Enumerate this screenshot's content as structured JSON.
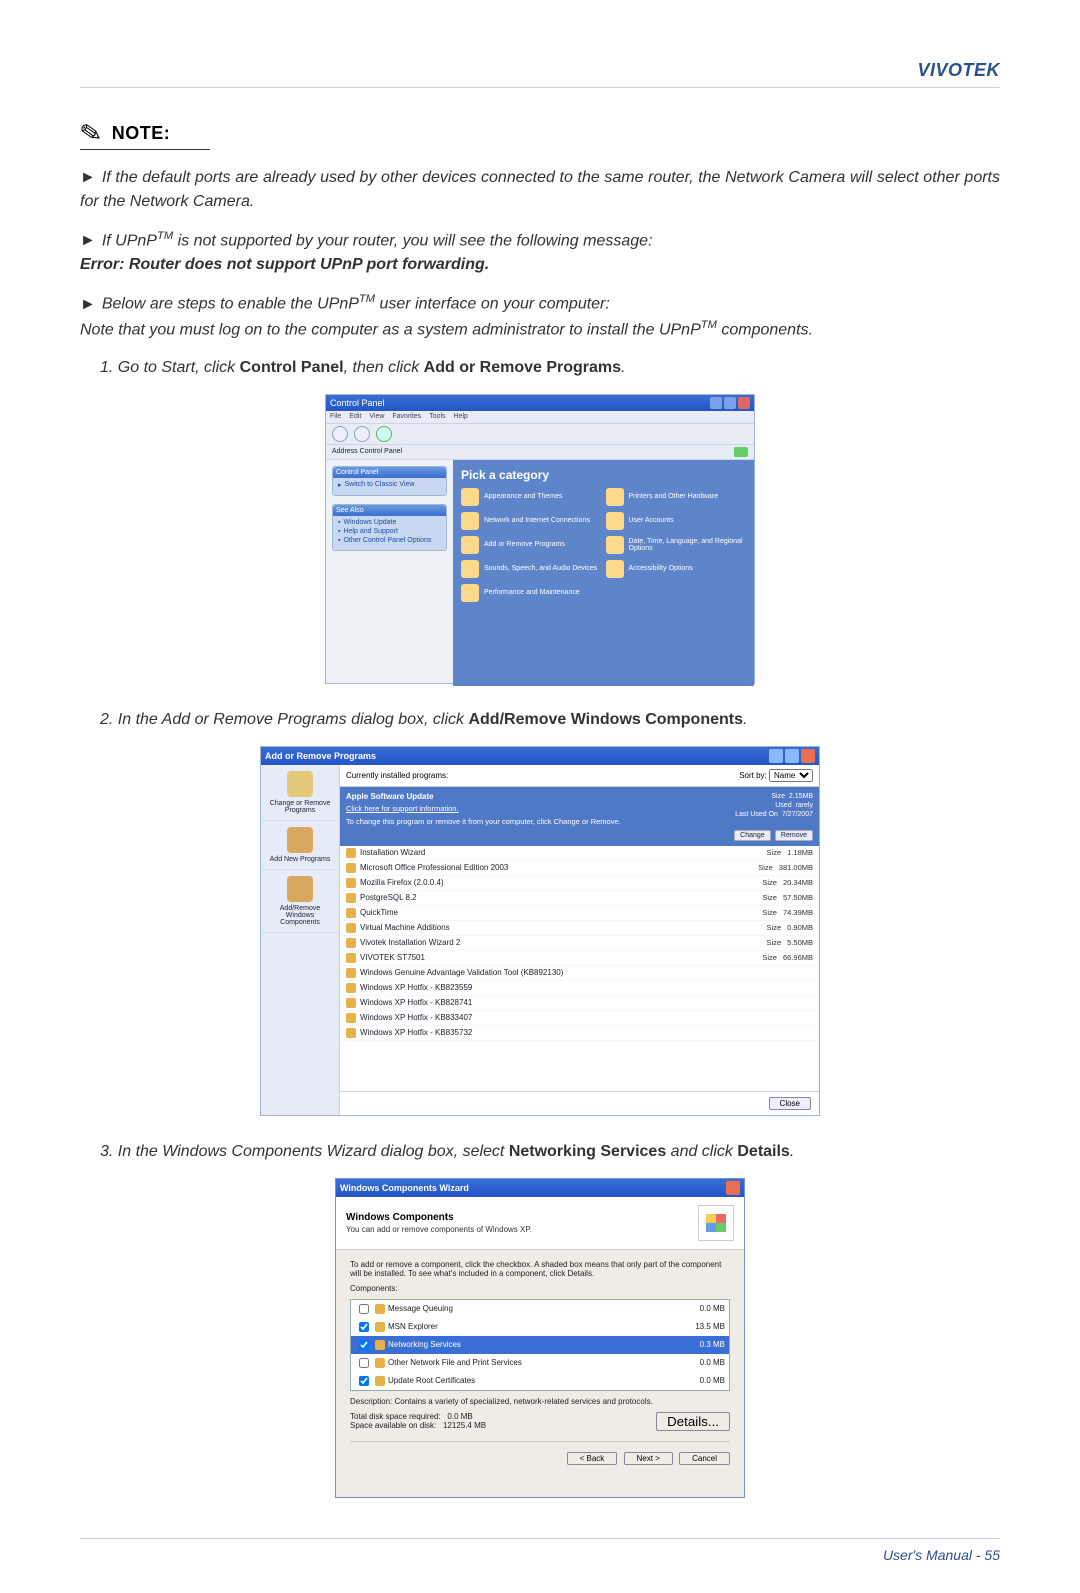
{
  "brand": "VIVOTEK",
  "note_label": "NOTE:",
  "bullets": {
    "b1": "If the default ports are already used by other devices connected to the same router, the Network Camera will select other ports for the Network Camera.",
    "b2_pre": "If UPnP",
    "b2_tm": "TM",
    "b2_post": " is not supported by your router, you will see the following message:",
    "b2_error": "Error: Router does not support UPnP port forwarding.",
    "b3_pre": "Below are steps to enable the UPnP",
    "b3_tm": "TM",
    "b3_post": " user interface on your computer:",
    "b3_note_pre": "Note that you must log on to the computer as a system administrator to install the UPnP",
    "b3_note_tm": "TM",
    "b3_note_post": " components."
  },
  "steps": {
    "s1_pre": "1. Go to Start, click ",
    "s1_bold1": "Control Panel",
    "s1_mid": ", then click ",
    "s1_bold2": "Add or Remove Programs",
    "s1_end": ".",
    "s2_pre": "2. In the Add or Remove Programs dialog box, click ",
    "s2_bold": "Add/Remove Windows Components",
    "s2_end": ".",
    "s3_pre": "3. In the Windows Components Wizard dialog box, select ",
    "s3_bold1": "Networking Services",
    "s3_mid": " and click ",
    "s3_bold2": "Details",
    "s3_end": "."
  },
  "cp": {
    "title": "Control Panel",
    "menu": [
      "File",
      "Edit",
      "View",
      "Favorites",
      "Tools",
      "Help"
    ],
    "address_label": "Address",
    "address_value": "Control Panel",
    "side_panel1_title": "Control Panel",
    "side_panel1_link": "Switch to Classic View",
    "side_panel2_title": "See Also",
    "side_panel2_links": [
      "Windows Update",
      "Help and Support",
      "Other Control Panel Options"
    ],
    "main_heading": "Pick a category",
    "categories": [
      "Appearance and Themes",
      "Printers and Other Hardware",
      "Network and Internet Connections",
      "User Accounts",
      "Add or Remove Programs",
      "Date, Time, Language, and Regional Options",
      "Sounds, Speech, and Audio Devices",
      "Accessibility Options",
      "Performance and Maintenance"
    ]
  },
  "arp": {
    "title": "Add or Remove Programs",
    "side": [
      {
        "label": "Change or Remove Programs"
      },
      {
        "label": "Add New Programs"
      },
      {
        "label": "Add/Remove Windows Components"
      }
    ],
    "top_label": "Currently installed programs:",
    "sort_label": "Sort by:",
    "sort_value": "Name",
    "selected": {
      "name": "Apple Software Update",
      "support": "Click here for support information.",
      "sizelabel": "Size",
      "size": "2.15MB",
      "usedlabel": "Used",
      "used": "rarely",
      "lastlabel": "Last Used On",
      "last": "7/27/2007",
      "msg": "To change this program or remove it from your computer, click Change or Remove.",
      "btn_change": "Change",
      "btn_remove": "Remove"
    },
    "rows": [
      {
        "name": "Installation Wizard",
        "size": "1.18MB"
      },
      {
        "name": "Microsoft Office Professional Edition 2003",
        "size": "381.00MB"
      },
      {
        "name": "Mozilla Firefox (2.0.0.4)",
        "size": "20.34MB"
      },
      {
        "name": "PostgreSQL 8.2",
        "size": "57.50MB"
      },
      {
        "name": "QuickTime",
        "size": "74.39MB"
      },
      {
        "name": "Virtual Machine Additions",
        "size": "0.90MB"
      },
      {
        "name": "Vivotek Installation Wizard 2",
        "size": "5.50MB"
      },
      {
        "name": "VIVOTEK ST7501",
        "size": "66.96MB"
      },
      {
        "name": "Windows Genuine Advantage Validation Tool (KB892130)",
        "size": ""
      },
      {
        "name": "Windows XP Hotfix - KB823559",
        "size": ""
      },
      {
        "name": "Windows XP Hotfix - KB828741",
        "size": ""
      },
      {
        "name": "Windows XP Hotfix - KB833407",
        "size": ""
      },
      {
        "name": "Windows XP Hotfix - KB835732",
        "size": ""
      }
    ],
    "size_col": "Size",
    "close": "Close"
  },
  "wcw": {
    "title": "Windows Components Wizard",
    "head_title": "Windows Components",
    "head_sub": "You can add or remove components of Windows XP.",
    "instr": "To add or remove a component, click the checkbox. A shaded box means that only part of the component will be installed. To see what's included in a component, click Details.",
    "components_label": "Components:",
    "items": [
      {
        "name": "Message Queuing",
        "size": "0.0 MB",
        "checked": false
      },
      {
        "name": "MSN Explorer",
        "size": "13.5 MB",
        "checked": true
      },
      {
        "name": "Networking Services",
        "size": "0.3 MB",
        "checked": true,
        "selected": true
      },
      {
        "name": "Other Network File and Print Services",
        "size": "0.0 MB",
        "checked": false
      },
      {
        "name": "Update Root Certificates",
        "size": "0.0 MB",
        "checked": true
      }
    ],
    "desc_label": "Description:",
    "desc": "Contains a variety of specialized, network-related services and protocols.",
    "space_req_label": "Total disk space required:",
    "space_req": "0.0 MB",
    "space_avail_label": "Space available on disk:",
    "space_avail": "12125.4 MB",
    "details_btn": "Details...",
    "back": "< Back",
    "next": "Next >",
    "cancel": "Cancel"
  },
  "footer": "User's Manual - 55"
}
